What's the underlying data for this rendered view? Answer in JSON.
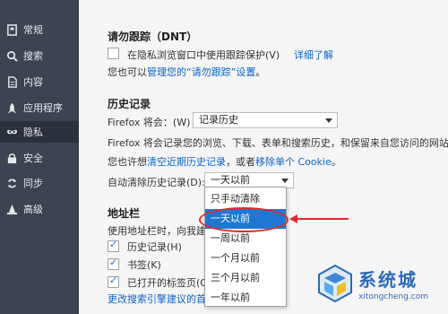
{
  "sidebar": {
    "items": [
      {
        "label": "常规",
        "icon": "document-icon"
      },
      {
        "label": "搜索",
        "icon": "search-icon"
      },
      {
        "label": "内容",
        "icon": "page-icon"
      },
      {
        "label": "应用程序",
        "icon": "rocket-icon"
      },
      {
        "label": "隐私",
        "icon": "mask-icon"
      },
      {
        "label": "安全",
        "icon": "lock-icon"
      },
      {
        "label": "同步",
        "icon": "sync-icon"
      },
      {
        "label": "高级",
        "icon": "wizard-hat-icon"
      }
    ],
    "active_index": 4
  },
  "tracking": {
    "heading": "请勿跟踪（DNT）",
    "checkbox_label": "在隐私浏览窗口中使用跟踪保护(V)",
    "learn_more": "详细了解",
    "manage_prefix": "您也可以",
    "manage_link": "管理您的“请勿跟踪”设置",
    "manage_suffix": "。"
  },
  "history": {
    "heading": "历史记录",
    "firefox_will": "Firefox 将会：",
    "will_shortcut": "(W)",
    "mode_value": "记录历史",
    "description": "Firefox 将会记录您的浏览、下载、表单和搜索历史，和保留来自您访问的网站的",
    "clear_prefix": "您也许想",
    "clear_link": "清空近期历史记录",
    "clear_middle": "，或者",
    "remove_link": "移除单个 Cookie",
    "clear_suffix": "。",
    "auto_clear_label": "自动清除历史记录(D):",
    "auto_clear_value": "一天以前"
  },
  "address_bar": {
    "heading": "地址栏",
    "desc": "使用地址栏时，向我建",
    "options": [
      {
        "label": "历史记录(H)",
        "checked": true
      },
      {
        "label": "书签(K)",
        "checked": true
      },
      {
        "label": "已打开的标签页(O)",
        "checked": true
      }
    ],
    "change_link": "更改搜索引擎建议的首"
  },
  "dropdown": {
    "options": [
      "只手动清除",
      "一天以前",
      "一周以前",
      "一个月以前",
      "三个月以前",
      "一年以前"
    ],
    "selected_index": 1
  },
  "watermark": {
    "cn": "系统城",
    "en": "xitongcheng.com"
  },
  "colors": {
    "sidebar_bg": "#3c4451",
    "accent": "#1e78d2",
    "annotation": "#e02a2a",
    "link": "#0a64c8"
  }
}
